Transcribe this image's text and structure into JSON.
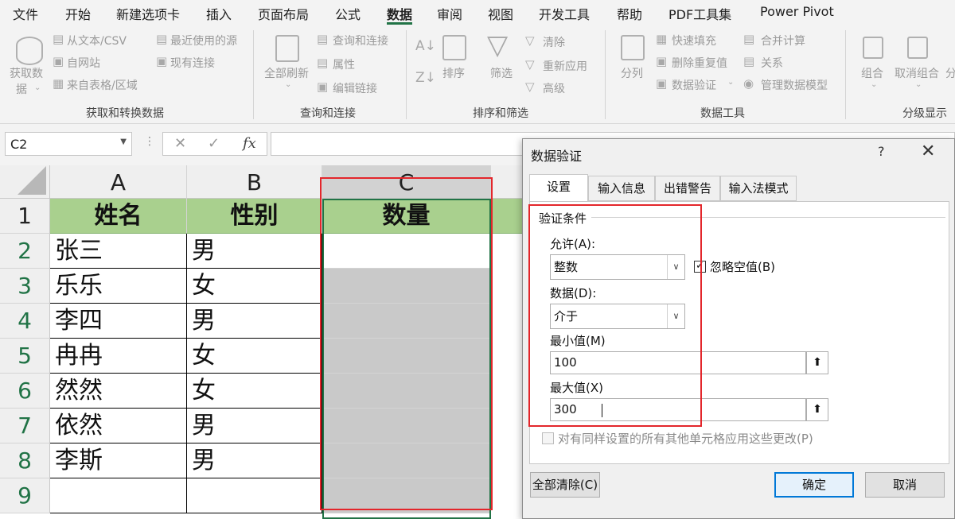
{
  "menu": {
    "items": [
      "文件",
      "开始",
      "新建选项卡",
      "插入",
      "页面布局",
      "公式",
      "数据",
      "审阅",
      "视图",
      "开发工具",
      "帮助",
      "PDF工具集",
      "Power Pivot"
    ],
    "active": "数据"
  },
  "ribbon": {
    "get_transform": {
      "get_data": "获取数",
      "get_data_2": "据",
      "from_text": "从文本/CSV",
      "from_web": "自网站",
      "from_table": "来自表格/区域",
      "recent_sources": "最近使用的源",
      "existing_conn": "现有连接",
      "label": "获取和转换数据"
    },
    "queries": {
      "refresh_all": "全部刷新",
      "queries_conn": "查询和连接",
      "properties": "属性",
      "edit_links": "编辑链接",
      "label": "查询和连接"
    },
    "sort_filter": {
      "sort": "排序",
      "filter": "筛选",
      "clear": "清除",
      "reapply": "重新应用",
      "advanced": "高级",
      "label": "排序和筛选"
    },
    "data_tools": {
      "split": "分列",
      "flash_fill": "快速填充",
      "remove_dup": "删除重复值",
      "validation": "数据验证",
      "consolidate": "合并计算",
      "relations": "关系",
      "manage_model": "管理数据模型",
      "label": "数据工具"
    },
    "outline": {
      "group": "组合",
      "ungroup": "取消组合",
      "label": "分级显示",
      "more": "分"
    }
  },
  "formula_bar": {
    "name_box": "C2",
    "cancel_icon": "✕",
    "enter_icon": "✓",
    "fx_icon": "fx",
    "value": ""
  },
  "grid": {
    "columns": [
      "A",
      "B",
      "C"
    ],
    "rows": [
      "1",
      "2",
      "3",
      "4",
      "5",
      "6",
      "7",
      "8",
      "9"
    ],
    "header": [
      "姓名",
      "性别",
      "数量"
    ],
    "data": [
      [
        "张三",
        "男"
      ],
      [
        "乐乐",
        "女"
      ],
      [
        "李四",
        "男"
      ],
      [
        "冉冉",
        "女"
      ],
      [
        "然然",
        "女"
      ],
      [
        "依然",
        "男"
      ],
      [
        "李斯",
        "男"
      ]
    ],
    "header_color": "#a9d08e"
  },
  "dialog": {
    "title": "数据验证",
    "help": "?",
    "close": "✕",
    "tabs": [
      "设置",
      "输入信息",
      "出错警告",
      "输入法模式"
    ],
    "section": "验证条件",
    "allow_label": "允许(A):",
    "allow_value": "整数",
    "ignore_blank": "忽略空值(B)",
    "ignore_blank_checked": true,
    "data_label": "数据(D):",
    "data_value": "介于",
    "min_label": "最小值(M)",
    "min_value": "100",
    "max_label": "最大值(X)",
    "max_value": "300",
    "apply_all": "对有同样设置的所有其他单元格应用这些更改(P)",
    "clear_all": "全部清除(C)",
    "ok": "确定",
    "cancel": "取消",
    "highlight_color": "#e3262b"
  }
}
